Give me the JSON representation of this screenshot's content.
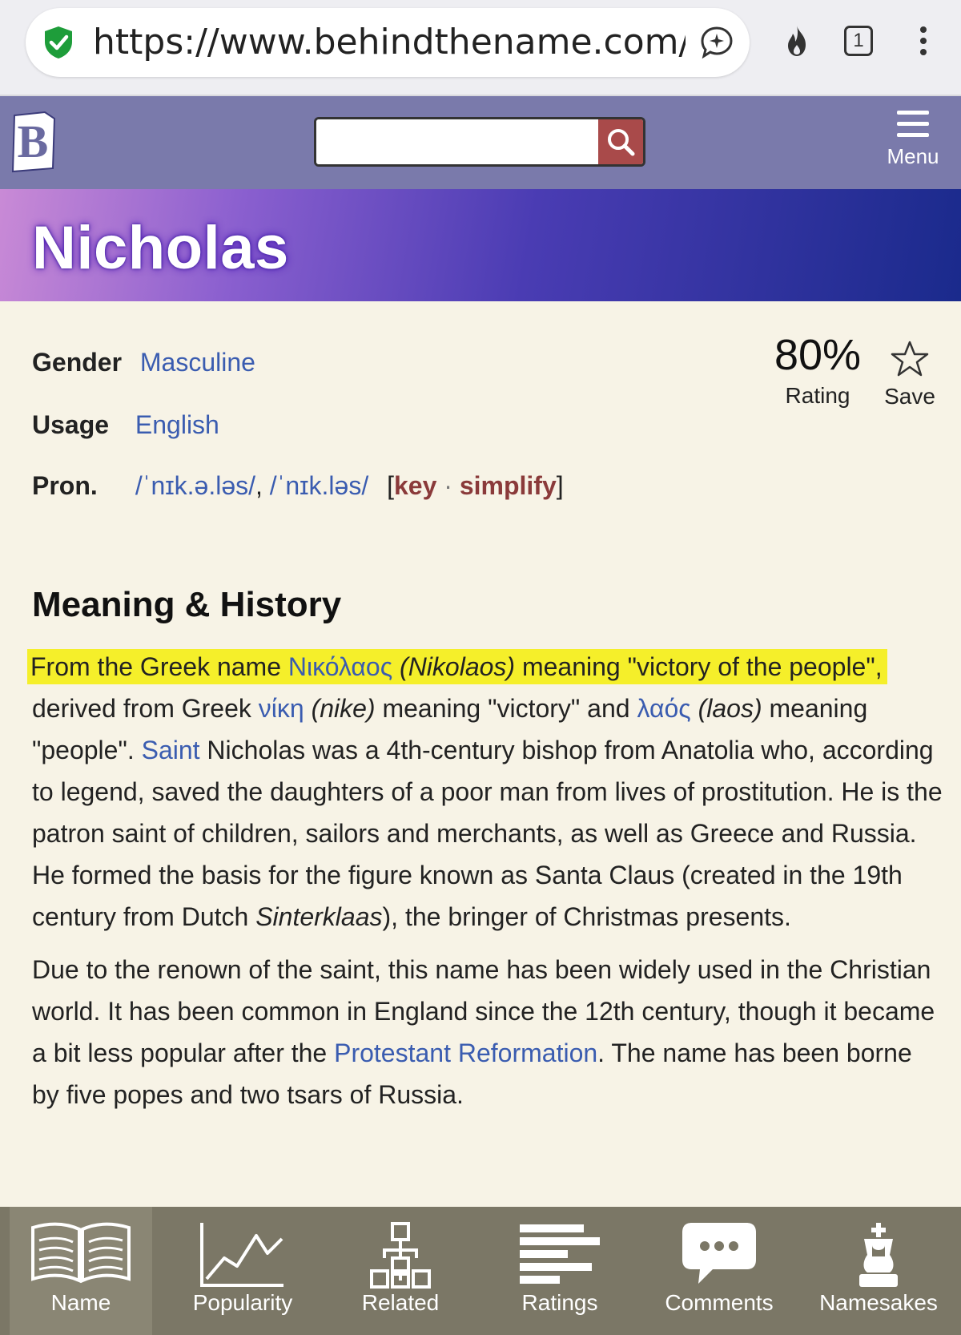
{
  "browser": {
    "url": "https://www.behindthename.com/na",
    "tab_count": "1"
  },
  "header": {
    "logo_letter": "B",
    "search_placeholder": "",
    "menu_label": "Menu"
  },
  "page": {
    "title": "Nicholas",
    "rating_value": "80%",
    "rating_label": "Rating",
    "save_label": "Save",
    "gender_label": "Gender",
    "gender_value": "Masculine",
    "usage_label": "Usage",
    "usage_value": "English",
    "pron_label": "Pron.",
    "pron_1": "/ˈnɪk.ə.ləs/",
    "pron_sep": ", ",
    "pron_2": "/ˈnɪk.ləs/",
    "bracket_open": "[",
    "key_label": "key",
    "dot": " · ",
    "simplify_label": "simplify",
    "bracket_close": "]",
    "section_heading": "Meaning & History"
  },
  "meaning": {
    "p1_a": "From the Greek name ",
    "p1_greek_name": "Νικόλαος",
    "p1_translit": " (Nikolaos)",
    "p1_b": " meaning \"victory of the people\",",
    "p1_c": "derived from Greek ",
    "p1_nike_greek": "νίκη",
    "p1_nike": " (nike)",
    "p1_d": " meaning \"victory\" and ",
    "p1_laos_greek": "λαός",
    "p1_laos": " (laos)",
    "p1_e": " meaning",
    "p1_f": "\"people\". ",
    "p1_saint": "Saint",
    "p1_g": " Nicholas was a 4th-century bishop from Anatolia who, according to legend, saved the daughters of a poor man from lives of prostitution. He is the patron saint of children, sailors and merchants, as well as Greece and Russia. He formed the basis for the figure known as Santa Claus (created in the 19th century from Dutch ",
    "p1_sinterklaas": "Sinterklaas",
    "p1_h": "), the bringer of Christmas presents.",
    "p2_a": "Due to the renown of the saint, this name has been widely used in the Christian world. It has been common in England since the 12th century, though it became a bit less popular after the ",
    "p2_link": "Protestant Reformation",
    "p2_b": ". The name has been borne by five popes and two tsars of Russia."
  },
  "bottom_nav": {
    "items": [
      {
        "label": "Name",
        "icon": "open-book-icon"
      },
      {
        "label": "Popularity",
        "icon": "line-chart-icon"
      },
      {
        "label": "Related",
        "icon": "family-tree-icon"
      },
      {
        "label": "Ratings",
        "icon": "bar-list-icon"
      },
      {
        "label": "Comments",
        "icon": "speech-bubble-icon"
      },
      {
        "label": "Namesakes",
        "icon": "king-piece-icon"
      }
    ]
  },
  "colors": {
    "header_bg": "#7a7aab",
    "link": "#3a5cb0",
    "highlight": "#f5ef2a",
    "search_button": "#a94a4a",
    "nav_bg": "#7b7766"
  }
}
